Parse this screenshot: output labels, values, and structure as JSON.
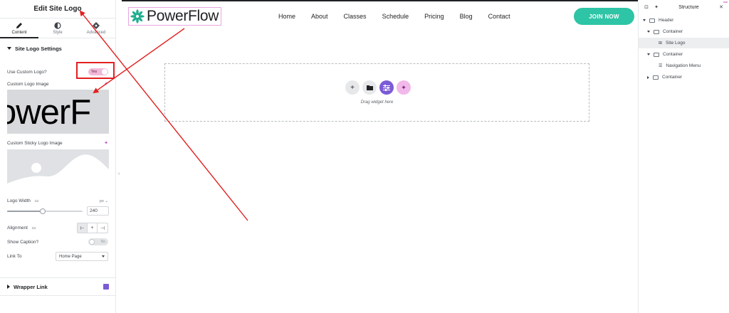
{
  "panel": {
    "title": "Edit Site Logo",
    "tabs": [
      {
        "label": "Content",
        "icon": "pencil-icon",
        "active": true
      },
      {
        "label": "Style",
        "icon": "half-circle-icon",
        "active": false
      },
      {
        "label": "Advanced",
        "icon": "gear-icon",
        "active": false
      }
    ],
    "section_title": "Site Logo Settings",
    "use_custom_logo": {
      "label": "Use Custom Logo?",
      "value": "Yes"
    },
    "custom_logo_image": {
      "label": "Custom Logo Image",
      "preview_text": "owerF"
    },
    "custom_sticky_logo_image": {
      "label": "Custom Sticky Logo Image"
    },
    "logo_width": {
      "label": "Logo Width",
      "unit": "px",
      "value": "240",
      "slider_fraction": 0.47
    },
    "alignment": {
      "label": "Alignment",
      "options": [
        "⊢",
        "+",
        "⊣"
      ],
      "active_index": 0
    },
    "show_caption": {
      "label": "Show Caption?",
      "value": "No"
    },
    "link_to": {
      "label": "Link To",
      "value": "Home Page"
    },
    "wrapper_link": {
      "label": "Wrapper Link"
    }
  },
  "canvas": {
    "logo_text": "PowerFlow",
    "nav_links": [
      "Home",
      "About",
      "Classes",
      "Schedule",
      "Pricing",
      "Blog",
      "Contact"
    ],
    "join_button": "JOIN NOW",
    "drop_zone_text": "Drag widget here",
    "colors": {
      "accent": "#2ec4a6",
      "logo_green": "#1fae8f",
      "purple": "#7b5bd6",
      "pink": "#e8a6e0"
    }
  },
  "structure": {
    "title": "Structure",
    "items": [
      {
        "label": "Header",
        "level": 0,
        "caret": "down",
        "selected": false
      },
      {
        "label": "Container",
        "level": 1,
        "caret": "down",
        "selected": false
      },
      {
        "label": "Site Logo",
        "level": 2,
        "caret": "none",
        "selected": true
      },
      {
        "label": "Container",
        "level": 1,
        "caret": "down",
        "selected": false
      },
      {
        "label": "Navigation Menu",
        "level": 2,
        "caret": "none",
        "selected": false
      },
      {
        "label": "Container",
        "level": 1,
        "caret": "right",
        "selected": false
      }
    ]
  }
}
